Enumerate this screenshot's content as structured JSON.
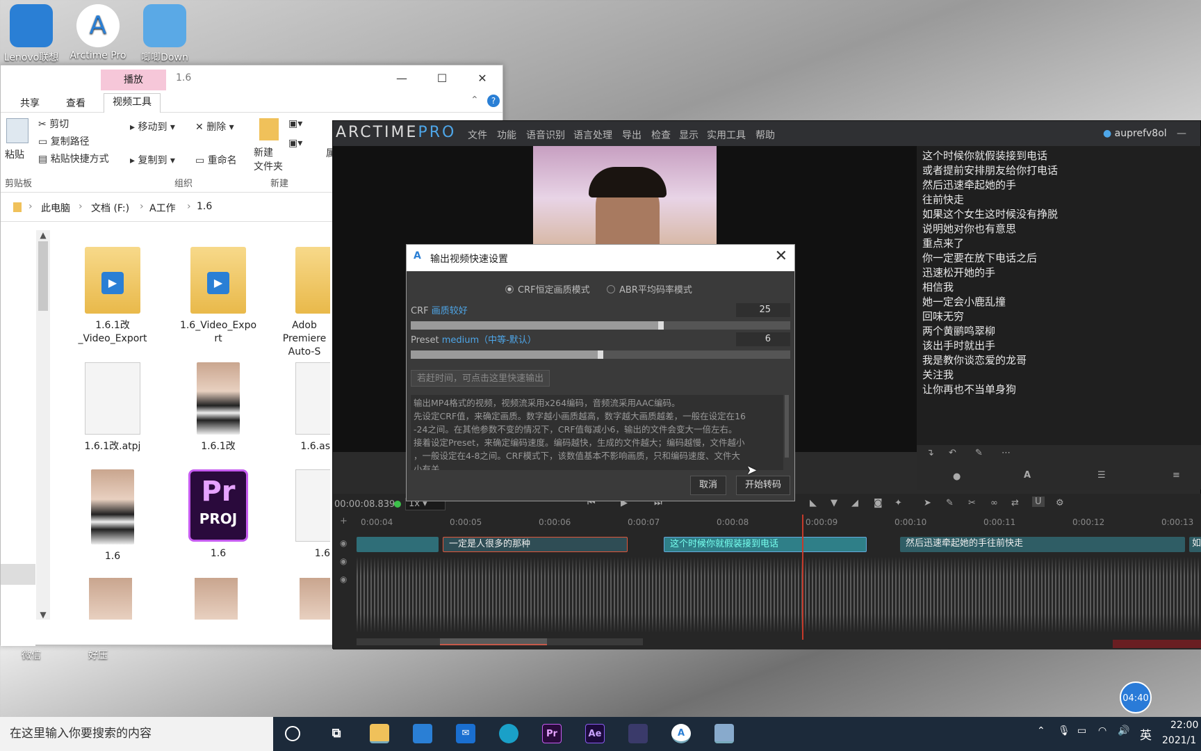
{
  "desktop": {
    "icons": [
      {
        "label": "Lenovo联想"
      },
      {
        "label": "Arctime Pro"
      },
      {
        "label": "唧唧Down"
      }
    ],
    "bottom_icons": [
      {
        "label": "微信"
      },
      {
        "label": "好压"
      }
    ]
  },
  "explorer": {
    "context_tab": "播放",
    "title": "1.6",
    "tabs": [
      "共享",
      "查看",
      "视频工具"
    ],
    "ribbon": {
      "paste": "粘贴",
      "cut": "剪切",
      "copy_path": "复制路径",
      "paste_shortcut": "粘贴快捷方式",
      "move_to": "移动到",
      "copy_to": "复制到",
      "delete": "删除",
      "rename": "重命名",
      "new_folder": "新建\n文件夹",
      "group_clipboard": "剪贴板",
      "group_organize": "组织",
      "group_new": "新建",
      "attr": "属"
    },
    "breadcrumb": [
      "此电脑",
      "文档 (F:)",
      "A工作",
      "1.6"
    ],
    "files": [
      {
        "name": "1.6.1改_Video_Export",
        "l1": "1.6.1改",
        "l2": "_Video_Export"
      },
      {
        "name": "1.6_Video_Export",
        "l1": "1.6_Video_Expo",
        "l2": "rt"
      },
      {
        "name": "Adobe Premiere Auto-S",
        "l1": "Adob",
        "l2": "Premiere",
        "l3": "Auto-S"
      },
      {
        "name": "1.6.1改.atpj",
        "l1": "1.6.1改.atpj"
      },
      {
        "name": "1.6.1改",
        "l1": "1.6.1改"
      },
      {
        "name": "1.6.as",
        "l1": "1.6.as"
      },
      {
        "name": "1.6",
        "l1": "1.6"
      },
      {
        "name": "1.6",
        "l1": "1.6"
      },
      {
        "name": "1.6",
        "l1": "1.6"
      }
    ]
  },
  "arctime": {
    "logo_text": "ARCTIME",
    "logo_accent": "PRO",
    "menu": [
      "文件",
      "功能",
      "语音识别",
      "语言处理",
      "导出",
      "检查",
      "显示",
      "实用工具",
      "帮助"
    ],
    "user": "auprefv8ol",
    "subtitles": [
      "这个时候你就假装接到电话",
      "或者提前安排朋友给你打电话",
      "然后迅速牵起她的手",
      "往前快走",
      "如果这个女生这时候没有挣脱",
      "说明她对你也有意思",
      "重点来了",
      "你一定要在放下电话之后",
      "迅速松开她的手",
      "相信我",
      "她一定会小鹿乱撞",
      "回味无穷",
      "两个黄鹂鸣翠柳",
      "该出手时就出手",
      "我是教你谈恋爱的龙哥",
      "关注我",
      "让你再也不当单身狗"
    ],
    "timecode": "00:00:08.839",
    "speed": "1x",
    "ruler": [
      "0:00:04",
      "0:00:05",
      "0:00:06",
      "0:00:07",
      "0:00:08",
      "0:00:09",
      "0:00:10",
      "0:00:11",
      "0:00:12",
      "0:00:13"
    ],
    "clips": [
      {
        "text": "一定是人很多的那种"
      },
      {
        "text": "这个时候你就假装接到电话"
      },
      {
        "text": "然后迅速牵起她的手往前快走"
      },
      {
        "text": "如"
      }
    ]
  },
  "dialog": {
    "title": "输出视频快速设置",
    "mode_crf": "CRF恒定画质模式",
    "mode_abr": "ABR平均码率模式",
    "crf_label": "CRF",
    "crf_hint": "画质较好",
    "crf_value": "25",
    "crf_level": 0.66,
    "preset_label": "Preset",
    "preset_hint": "medium（中等-默认）",
    "preset_value": "6",
    "preset_level": 0.5,
    "quick_hint": "若赶时间，可点击这里快速输出",
    "description": [
      "输出MP4格式的视频，视频流采用x264编码，音频流采用AAC编码。",
      "先设定CRF值，来确定画质。数字越小画质越高，数字越大画质越差，一般在设定在16",
      "-24之间。在其他参数不变的情况下，CRF值每减小6，输出的文件会变大一倍左右。",
      "接着设定Preset，来确定编码速度。编码越快，生成的文件越大；编码越慢，文件越小",
      "，一般设定在4-8之间。CRF模式下，该数值基本不影响画质，只和编码速度、文件大",
      "小有关。"
    ],
    "cancel": "取消",
    "start": "开始转码"
  },
  "taskbar": {
    "search_placeholder": "在这里输入你要搜索的内容",
    "ime": "英",
    "time": "22:00",
    "date": "2021/1",
    "timer": "04:40"
  }
}
